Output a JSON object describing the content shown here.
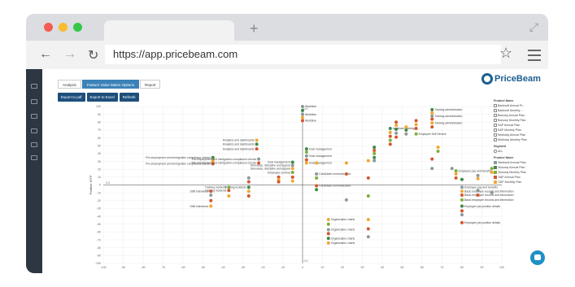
{
  "browser": {
    "url": "https://app.pricebeam.com"
  },
  "app": {
    "logo_text": "PriceBeam",
    "tabs": [
      {
        "label": "Analysis",
        "active": false
      },
      {
        "label": "Feature Value Matrix Options",
        "active": true
      },
      {
        "label": "Report",
        "active": false
      }
    ],
    "actions": [
      "Export to pdf",
      "Export to Excel",
      "Refresh"
    ]
  },
  "legend": {
    "product_title": "Product Name",
    "products": [
      "Banksoft Annual Pr...",
      "Banksoft Monthly ...",
      "Bonusly Annual Plan",
      "Bonusly Monthly Plan",
      "SAP Annual Plan",
      "SAP Monthly Plan",
      "Workday Annual Plan",
      "Workday Monthly Plan"
    ],
    "segment_title": "Segment",
    "segment_value": "ALL",
    "color_title": "Product Name",
    "colors": [
      {
        "name": "Banksoft Annual Plan",
        "color": "#8a9a9a"
      },
      {
        "name": "Bonusly Annual Plan",
        "color": "#3f8a4a"
      },
      {
        "name": "Bonusly Monthly Plan",
        "color": "#7fae3c"
      },
      {
        "name": "SAP Annual Plan",
        "color": "#d4562e"
      },
      {
        "name": "SAP Monthly Plan",
        "color": "#f0a732"
      }
    ]
  },
  "chart_data": {
    "type": "scatter",
    "ylabel": "Positive WTP",
    "xlim": [
      -100,
      100
    ],
    "ylim": [
      -100,
      100
    ],
    "xticks": [
      -100,
      -90,
      -80,
      -70,
      -60,
      -50,
      -40,
      -30,
      -20,
      -10,
      0,
      10,
      20,
      30,
      40,
      50,
      60,
      70,
      80,
      90,
      100
    ],
    "yticks": [
      -100,
      -90,
      -80,
      -70,
      -60,
      -50,
      -40,
      -30,
      -20,
      -10,
      0,
      10,
      20,
      30,
      40,
      50,
      60,
      70,
      80,
      90,
      100
    ],
    "center_labels": [
      "0.0",
      "0.0",
      "0.0"
    ],
    "points": [
      {
        "x": 0,
        "y": 100,
        "color": "#8a9a9a",
        "label": "Workflow"
      },
      {
        "x": 0,
        "y": 95,
        "color": "#3f8a4a"
      },
      {
        "x": 0,
        "y": 90,
        "color": "#8a9a9a",
        "label": "Workflow"
      },
      {
        "x": 0,
        "y": 86,
        "color": "#f0a732"
      },
      {
        "x": 0,
        "y": 82,
        "color": "#d4562e",
        "label": "Workflow"
      },
      {
        "x": -23,
        "y": 57,
        "color": "#f0a732",
        "label": "Analytics and dashboards"
      },
      {
        "x": -23,
        "y": 52,
        "color": "#3f8a4a",
        "label": "Analytics and dashboards"
      },
      {
        "x": -23,
        "y": 46,
        "color": "#d4562e",
        "label": "Analytics and dashboards"
      },
      {
        "x": 2,
        "y": 46,
        "color": "#3f8a4a",
        "label": "Goal management"
      },
      {
        "x": 2,
        "y": 42,
        "color": "#7fae3c"
      },
      {
        "x": 2,
        "y": 37,
        "color": "#8a9a9a",
        "label": "Goal management"
      },
      {
        "x": 2,
        "y": 32,
        "color": "#d4562e"
      },
      {
        "x": 2,
        "y": 28,
        "color": "#f0a732",
        "label": "Goal management"
      },
      {
        "x": -45,
        "y": 35,
        "color": "#3f8a4a",
        "label": "Pre-employment and immigration compliance checks"
      },
      {
        "x": -45,
        "y": 31,
        "color": "#f0a732"
      },
      {
        "x": -45,
        "y": 27,
        "color": "#d4562e",
        "label": "Pre-employment and immigration compliance checks"
      },
      {
        "x": -22,
        "y": 33,
        "color": "#8a9a9a",
        "label": "Pre-employment and immigration compliance checks"
      },
      {
        "x": -22,
        "y": 28,
        "color": "#d4562e",
        "label": "Pre-employment and immigration compliance checks"
      },
      {
        "x": -5,
        "y": 29,
        "color": "#3f8a4a",
        "label": "Goal management"
      },
      {
        "x": -5,
        "y": 25,
        "color": "#8a9a9a",
        "label": "Grievance, discipline and appeal"
      },
      {
        "x": -5,
        "y": 21,
        "color": "#f0a732",
        "label": "Grievance, discipline and appeal"
      },
      {
        "x": -5,
        "y": 16,
        "color": "#7fae3c",
        "label": "Employee survival"
      },
      {
        "x": -5,
        "y": 10,
        "color": "#d4562e"
      },
      {
        "x": -5,
        "y": 5,
        "color": "#f0a732"
      },
      {
        "x": 7,
        "y": 28,
        "color": "#f0a732"
      },
      {
        "x": 7,
        "y": 14,
        "color": "#8a9a9a",
        "label": "Candidate communication"
      },
      {
        "x": 7,
        "y": 9,
        "color": "#7fae3c"
      },
      {
        "x": 7,
        "y": -1,
        "color": "#d4562e",
        "label": "Candidate communication"
      },
      {
        "x": 7,
        "y": -6,
        "color": "#3f8a4a"
      },
      {
        "x": -12,
        "y": 10,
        "color": "#d4562e"
      },
      {
        "x": -12,
        "y": 7,
        "color": "#f0a732"
      },
      {
        "x": -12,
        "y": 4,
        "color": "#d4562e"
      },
      {
        "x": -27,
        "y": 9,
        "color": "#8a9a9a"
      },
      {
        "x": -27,
        "y": 4,
        "color": "#d4562e"
      },
      {
        "x": -27,
        "y": -3,
        "color": "#3f8a4a",
        "label": "Training incidents"
      },
      {
        "x": -27,
        "y": -8,
        "color": "#f0a732"
      },
      {
        "x": -27,
        "y": -14,
        "color": "#d4562e"
      },
      {
        "x": -37,
        "y": -3,
        "color": "#7fae3c",
        "label": "Training incidents"
      },
      {
        "x": -37,
        "y": -7,
        "color": "#d4562e",
        "label": "Training incidents"
      },
      {
        "x": -37,
        "y": -14,
        "color": "#f0a732"
      },
      {
        "x": -46,
        "y": -8,
        "color": "#d4562e",
        "label": "Shift interviews"
      },
      {
        "x": -46,
        "y": -13,
        "color": "#8a9a9a"
      },
      {
        "x": -46,
        "y": -20,
        "color": "#d4562e"
      },
      {
        "x": -46,
        "y": -27,
        "color": "#f0a732",
        "label": "Shift interviews"
      },
      {
        "x": 22,
        "y": 28,
        "color": "#f0a732"
      },
      {
        "x": 22,
        "y": 14,
        "color": "#d4562e"
      },
      {
        "x": 22,
        "y": -19,
        "color": "#8a9a9a"
      },
      {
        "x": 33,
        "y": 31,
        "color": "#f0a732"
      },
      {
        "x": 33,
        "y": 9,
        "color": "#d4562e"
      },
      {
        "x": 33,
        "y": -14,
        "color": "#7fae3c"
      },
      {
        "x": 13,
        "y": -44,
        "color": "#f0a732",
        "label": "Organization charts"
      },
      {
        "x": 13,
        "y": -50,
        "color": "#7fae3c"
      },
      {
        "x": 13,
        "y": -57,
        "color": "#8a9a9a",
        "label": "Organization charts"
      },
      {
        "x": 13,
        "y": -62,
        "color": "#d4562e"
      },
      {
        "x": 13,
        "y": -68,
        "color": "#3f8a4a",
        "label": "Organization charts"
      },
      {
        "x": 13,
        "y": -74,
        "color": "#f0a732",
        "label": "Organization charts"
      },
      {
        "x": 33,
        "y": -44,
        "color": "#f0a732"
      },
      {
        "x": 33,
        "y": -56,
        "color": "#d4562e"
      },
      {
        "x": 33,
        "y": -66,
        "color": "#8a9a9a"
      },
      {
        "x": 36,
        "y": 48,
        "color": "#3f8a4a"
      },
      {
        "x": 36,
        "y": 44,
        "color": "#d4562e"
      },
      {
        "x": 36,
        "y": 40,
        "color": "#7fae3c"
      },
      {
        "x": 36,
        "y": 35,
        "color": "#3f8a4a"
      },
      {
        "x": 36,
        "y": 31,
        "color": "#8a9a9a"
      },
      {
        "x": 44,
        "y": 72,
        "color": "#3f8a4a",
        "label": "Applicant tracking"
      },
      {
        "x": 44,
        "y": 67,
        "color": "#f0a732"
      },
      {
        "x": 44,
        "y": 62,
        "color": "#d4562e"
      },
      {
        "x": 44,
        "y": 57,
        "color": "#7fae3c"
      },
      {
        "x": 44,
        "y": 52,
        "color": "#d4562e"
      },
      {
        "x": 47,
        "y": 80,
        "color": "#d4562e"
      },
      {
        "x": 47,
        "y": 76,
        "color": "#f0a732"
      },
      {
        "x": 47,
        "y": 71,
        "color": "#3f8a4a"
      },
      {
        "x": 47,
        "y": 66,
        "color": "#8a9a9a"
      },
      {
        "x": 47,
        "y": 61,
        "color": "#d4562e"
      },
      {
        "x": 52,
        "y": 74,
        "color": "#f0a732"
      },
      {
        "x": 52,
        "y": 70,
        "color": "#3f8a4a"
      },
      {
        "x": 52,
        "y": 65,
        "color": "#8a9a9a"
      },
      {
        "x": 57,
        "y": 82,
        "color": "#d4562e"
      },
      {
        "x": 57,
        "y": 77,
        "color": "#f0a732"
      },
      {
        "x": 57,
        "y": 72,
        "color": "#d4562e"
      },
      {
        "x": 57,
        "y": 65,
        "color": "#7fae3c",
        "label": "Employee Self Service"
      },
      {
        "x": 65,
        "y": 96,
        "color": "#3f8a4a",
        "label": "Training administration"
      },
      {
        "x": 65,
        "y": 92,
        "color": "#f0a732"
      },
      {
        "x": 65,
        "y": 88,
        "color": "#8a9a9a",
        "label": "Training administration"
      },
      {
        "x": 65,
        "y": 84,
        "color": "#d4562e"
      },
      {
        "x": 65,
        "y": 79,
        "color": "#f0a732",
        "label": "Training administration"
      },
      {
        "x": 65,
        "y": 74,
        "color": "#d4562e"
      },
      {
        "x": 68,
        "y": 48,
        "color": "#f0a732"
      },
      {
        "x": 68,
        "y": 43,
        "color": "#7fae3c"
      },
      {
        "x": 65,
        "y": 33,
        "color": "#d4562e"
      },
      {
        "x": 65,
        "y": 21,
        "color": "#8a9a9a"
      },
      {
        "x": 75,
        "y": 21,
        "color": "#8a9a9a"
      },
      {
        "x": 77,
        "y": 18,
        "color": "#7fae3c",
        "label": "Employee pay and benefits"
      },
      {
        "x": 77,
        "y": 14,
        "color": "#f0a732"
      },
      {
        "x": 77,
        "y": 9,
        "color": "#d4562e"
      },
      {
        "x": 80,
        "y": 7,
        "color": "#3f8a4a"
      },
      {
        "x": 80,
        "y": -3,
        "color": "#8a9a9a",
        "label": "Employee pay and benefits"
      },
      {
        "x": 80,
        "y": -8,
        "color": "#f0a732",
        "label": "Basic employee records and information"
      },
      {
        "x": 80,
        "y": -13,
        "color": "#d4562e",
        "label": "Basic employee records and information"
      },
      {
        "x": 80,
        "y": -19,
        "color": "#7fae3c",
        "label": "Basic employee records and information"
      },
      {
        "x": 80,
        "y": -27,
        "color": "#3f8a4a",
        "label": "Employee job position details"
      },
      {
        "x": 80,
        "y": -33,
        "color": "#d4562e"
      },
      {
        "x": 80,
        "y": -38,
        "color": "#8a9a9a"
      },
      {
        "x": 80,
        "y": -48,
        "color": "#d4562e",
        "label": "Employee job position details"
      },
      {
        "x": 88,
        "y": 12,
        "color": "#8a9a9a"
      },
      {
        "x": 88,
        "y": 8,
        "color": "#f0a732"
      },
      {
        "x": 88,
        "y": -7,
        "color": "#8a9a9a"
      },
      {
        "x": 88,
        "y": -13,
        "color": "#d4562e"
      },
      {
        "x": 95,
        "y": 21,
        "color": "#7fae3c"
      },
      {
        "x": 95,
        "y": 16,
        "color": "#f0a732"
      },
      {
        "x": 95,
        "y": -10,
        "color": "#8a9a9a"
      }
    ]
  }
}
